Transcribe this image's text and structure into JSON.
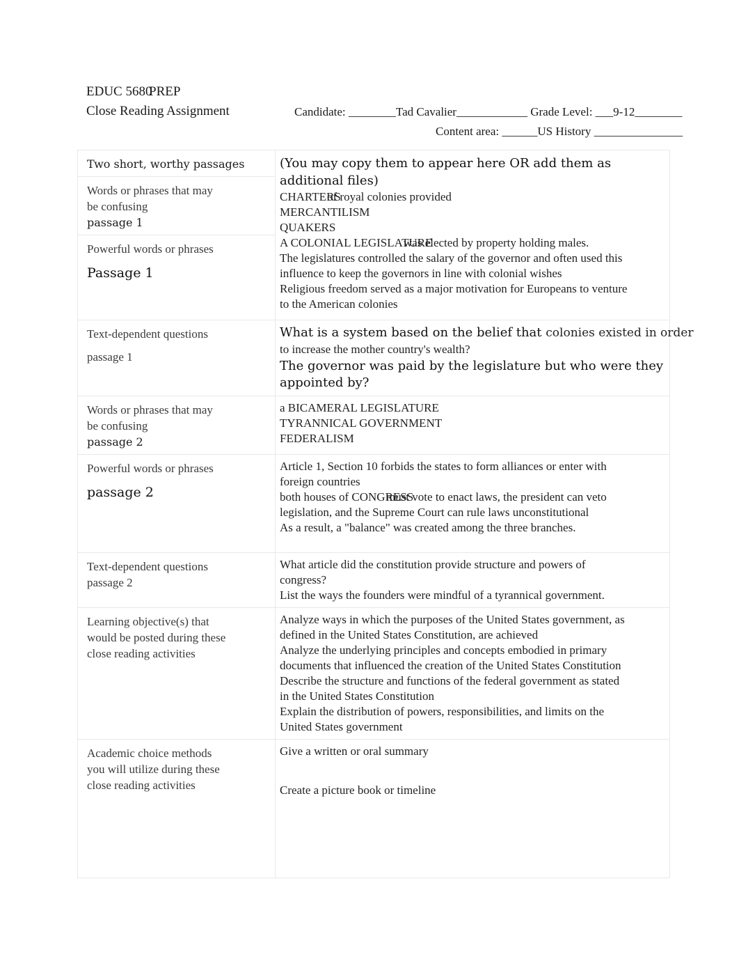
{
  "header": {
    "course_code": "EDUC 5680",
    "course_suffix": "PREP",
    "assignment_title": "Close Reading Assignment",
    "candidate_line": "Candidate:  ________Tad Cavalier____________  Grade Level:  ___9-12________",
    "content_area_line": "Content area:  ______US History _______________"
  },
  "table": {
    "rows": [
      {
        "label_lines": [
          "Two short, worthy passages"
        ],
        "value_lead": "(You may copy them to appear here OR add them as additional files)"
      },
      {
        "label_lines": [
          "Words or phrases that may",
          "be confusing"
        ],
        "label_emph": "passage 1"
      },
      {
        "label_lines": [
          "Powerful words or phrases"
        ],
        "label_big": "Passage 1"
      },
      {
        "label_lines": [
          "Text-dependent questions"
        ],
        "label_emph": "passage 1"
      },
      {
        "label_lines": [
          "Words or phrases that may",
          "be confusing"
        ],
        "label_emph": "passage 2"
      },
      {
        "label_lines": [
          "Powerful words or phrases"
        ],
        "label_big": "passage 2"
      },
      {
        "label_lines": [
          "Text-dependent questions",
          "passage 2"
        ]
      },
      {
        "label_lines": [
          "Learning objective(s) that",
          "would be posted during these",
          "close reading activities"
        ]
      },
      {
        "label_lines": [
          "Academic choice methods",
          "you will utilize during these",
          "close reading activities"
        ]
      }
    ]
  },
  "content": {
    "passage1_words": {
      "charters_term": "CHARTERS",
      "charters_rest": "of royal colonies provided",
      "mercantilism": "MERCANTILISM",
      "quakers": "QUAKERS"
    },
    "passage1_powerful": {
      "legislature_term": "A COLONIAL LEGISLATURE",
      "legislature_rest": "was elected by property holding males.",
      "line2a": "The legislatures controlled the salary of the governor and often used this",
      "line2b": "influence to keep the governors in line with colonial wishes",
      "line3a": "Religious freedom served as a major motivation for Europeans to venture",
      "line3b": "to the American colonies"
    },
    "passage1_questions": {
      "q1a": "What is a system based on the belief that",
      "q1b": "colonies existed in order",
      "q1c": "to increase the mother country's wealth?",
      "q2a": "The governor was paid by the legislature but who were they",
      "q2b": "appointed by?"
    },
    "passage2_words": {
      "bicameral": "a BICAMERAL LEGISLATURE",
      "tyrannical": "TYRANNICAL GOVERNMENT",
      "federalism": "FEDERALISM"
    },
    "passage2_powerful": {
      "line1a": "Article 1, Section 10 forbids the states to form alliances or enter with",
      "line1b": "foreign countries",
      "congress_lead": "both houses of  CONGRESS",
      "congress_rest": "must vote to enact laws, the president can veto",
      "line2b": "legislation, and the Supreme Court can rule laws unconstitutional",
      "line3": "As a result, a \"balance\" was created among the three branches."
    },
    "passage2_questions": {
      "q1a": "What article did the constitution provide structure and powers of",
      "q1b": "congress?",
      "q2": "List the ways the founders were mindful of a tyrannical government."
    },
    "learning_objectives": {
      "o1a": "Analyze ways in which the purposes of the United States government, as",
      "o1b": "defined in the United States Constitution, are achieved",
      "o2a": "Analyze the underlying principles and concepts embodied in primary",
      "o2b": "documents that influenced the creation of the United States Constitution",
      "o3a": "Describe the structure and functions of the federal government as stated",
      "o3b": "in the United States Constitution",
      "o4a": "Explain the distribution of powers, responsibilities, and limits on the",
      "o4b": "United States government"
    },
    "academic_choice": {
      "c1": "Give a written or oral summary",
      "c2": "Create a picture book or timeline"
    }
  }
}
